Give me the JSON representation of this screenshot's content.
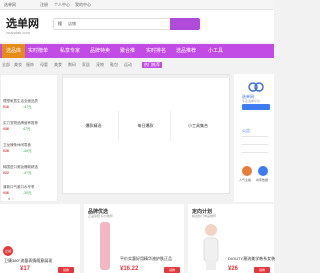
{
  "topbar": {
    "left": "选单网",
    "items": [
      "注册",
      "个人中心",
      "我的中心"
    ]
  },
  "header": {
    "logo": "选单网",
    "logo_sub": "xuandan.com",
    "search_tabs": [
      "搜",
      "店铺"
    ]
  },
  "nav": {
    "items": [
      "选品库",
      "实时榜单",
      "私享专家",
      "品牌特卖",
      "聚合推",
      "实时排名",
      "选品推荐",
      "小工具"
    ]
  },
  "catbar": {
    "items": [
      "全部",
      "美妆",
      "服饰",
      "母婴",
      "美食",
      "数码",
      "家居",
      "宠物",
      "鞋包",
      "运动",
      "热门推荐"
    ]
  },
  "left_panel": {
    "rows": [
      {
        "text": "理想家居生活全面品质",
        "price": "¥16",
        "sub": "-47元"
      },
      {
        "text": "实力宠物品牌营养推荐",
        "price": "¥36",
        "sub": "47元"
      },
      {
        "text": "卫龙辣条休闲零食",
        "price": "¥26",
        "sub": "-40元"
      },
      {
        "text": "韩国进口美妆爆款精选",
        "price": "¥22",
        "sub": "-47元"
      },
      {
        "text": "清新口气漱口水专享",
        "price": "¥36",
        "sub": "-30元"
      }
    ]
  },
  "banner": {
    "cards": [
      "爆款精选",
      "每日爆款",
      "小工具集合"
    ]
  },
  "right_panel": {
    "brand": "选单网",
    "brand_sub": "专业选单平台",
    "button": "登录/注册",
    "tab": "公告",
    "labels": [
      "人气主播",
      "商家数据"
    ]
  },
  "bottom": {
    "cols": [
      {
        "title": "",
        "text": "卫康360°流量表情随意展现",
        "price": "¥17",
        "button": "领券"
      },
      {
        "title": "品牌优选",
        "sub": "正品保障 好价推荐",
        "text": "平价实惠好用精华液护肤正品",
        "price": "¥16.22",
        "button": "领券"
      },
      {
        "title": "定向计划",
        "sub": "精选热门单品推荐",
        "text": "DIOUTY潮流美学韩系女装",
        "price": "¥26",
        "button": "领券"
      }
    ]
  },
  "badge": "立减"
}
